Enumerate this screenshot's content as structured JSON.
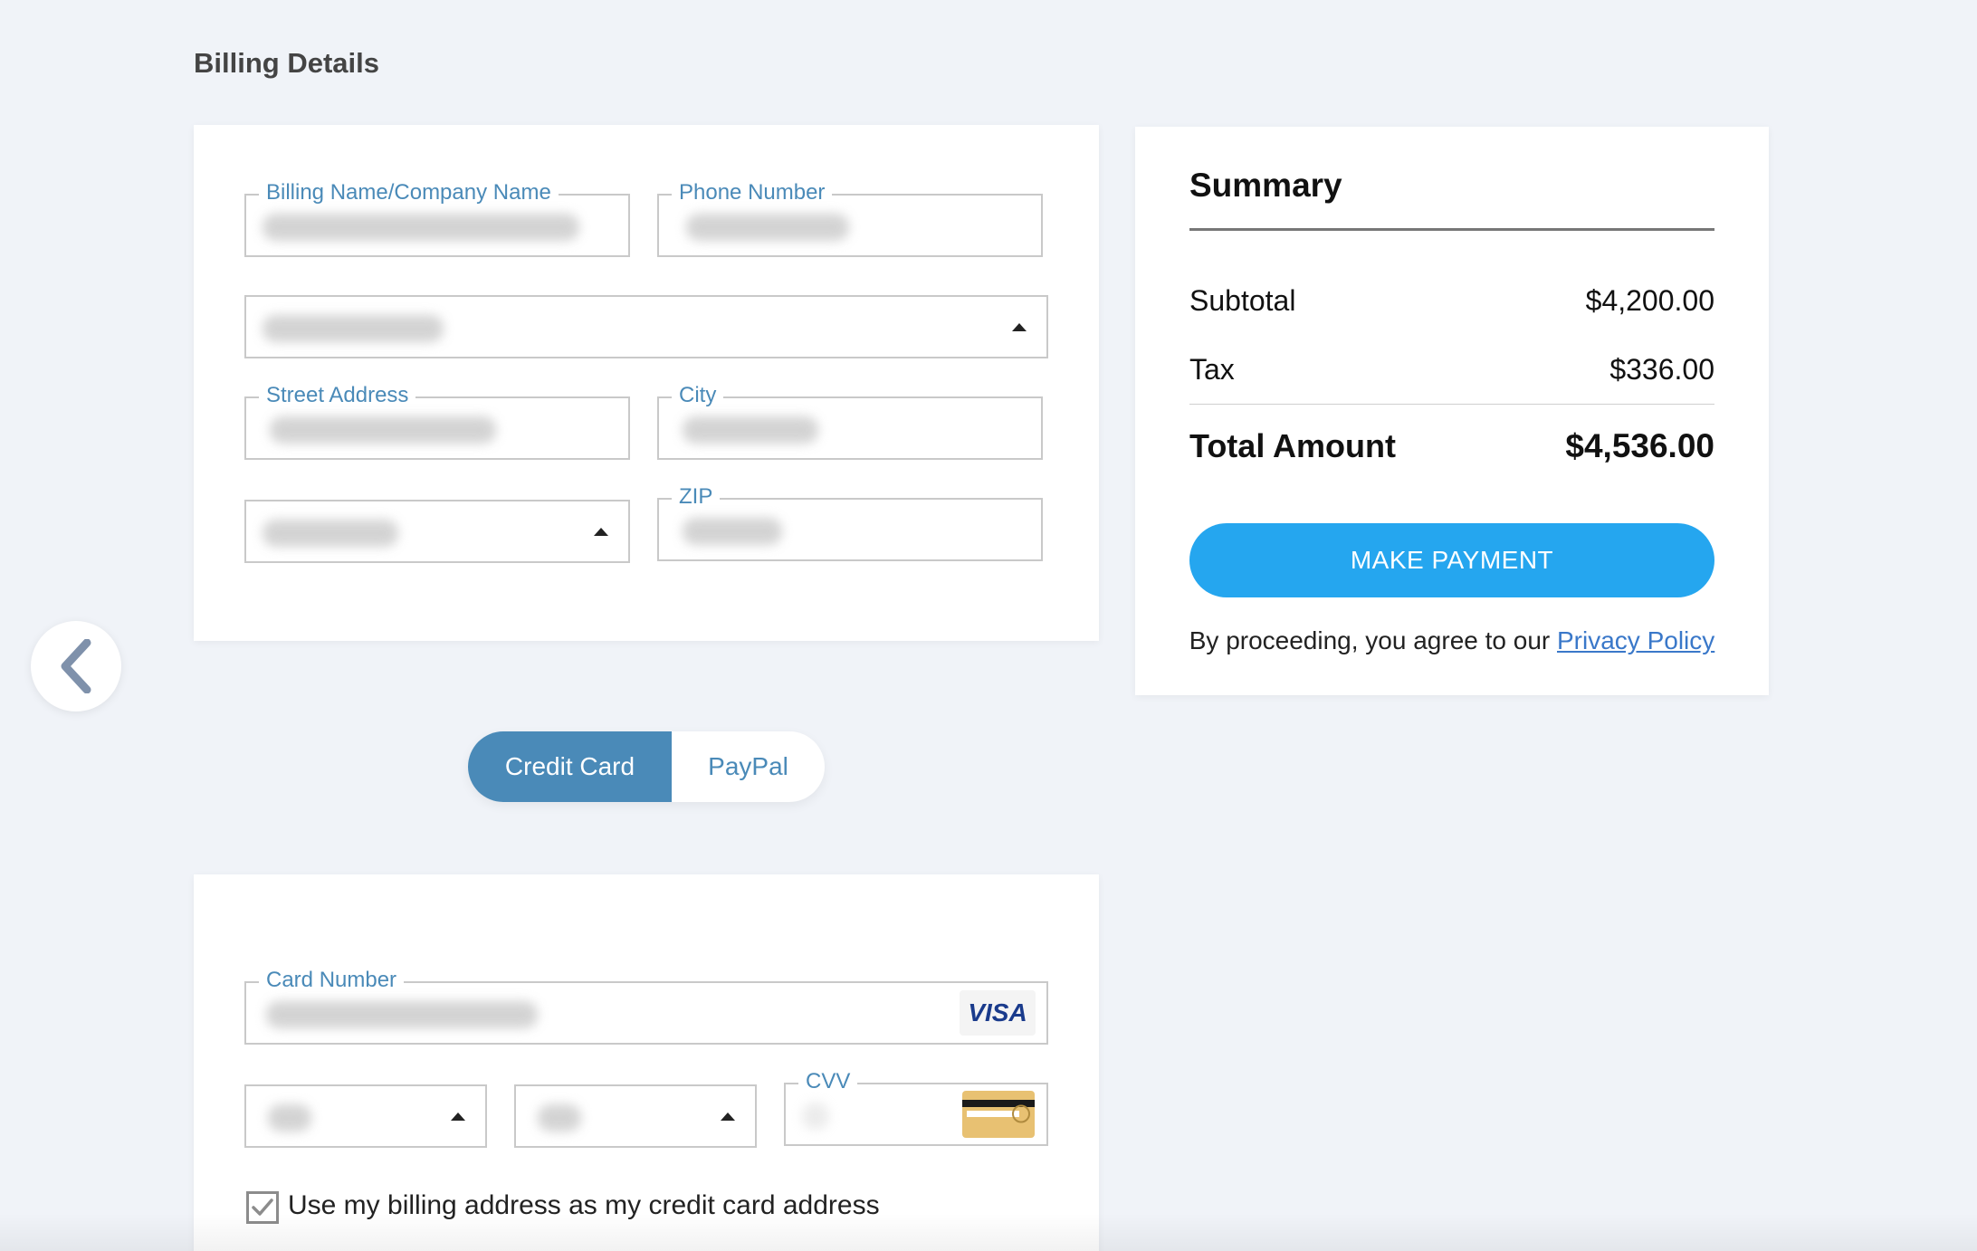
{
  "page": {
    "title": "Billing Details"
  },
  "billing": {
    "name_label": "Billing Name/Company Name",
    "phone_label": "Phone Number",
    "street_label": "Street Address",
    "city_label": "City",
    "zip_label": "ZIP"
  },
  "summary": {
    "title": "Summary",
    "subtotal_label": "Subtotal",
    "subtotal_value": "$4,200.00",
    "tax_label": "Tax",
    "tax_value": "$336.00",
    "total_label": "Total Amount",
    "total_value": "$4,536.00",
    "pay_button": "MAKE PAYMENT",
    "agree_text": "By proceeding, you agree to our ",
    "privacy_link": "Privacy Policy"
  },
  "payment_tabs": {
    "credit_card": "Credit Card",
    "paypal": "PayPal",
    "selected": "Credit Card"
  },
  "card": {
    "number_label": "Card Number",
    "brand": "VISA",
    "cvv_label": "CVV",
    "use_billing_label": "Use my billing address as my credit card address",
    "use_billing_checked": true
  },
  "colors": {
    "accent": "#4a8ab8",
    "pay_button": "#25a6ef",
    "background": "#f0f3f8"
  },
  "icons": {
    "back": "chevron-left-icon",
    "dropdown": "caret-up-icon",
    "visa": "visa-icon",
    "cvv": "card-back-icon",
    "checkbox": "checkmark-icon"
  }
}
